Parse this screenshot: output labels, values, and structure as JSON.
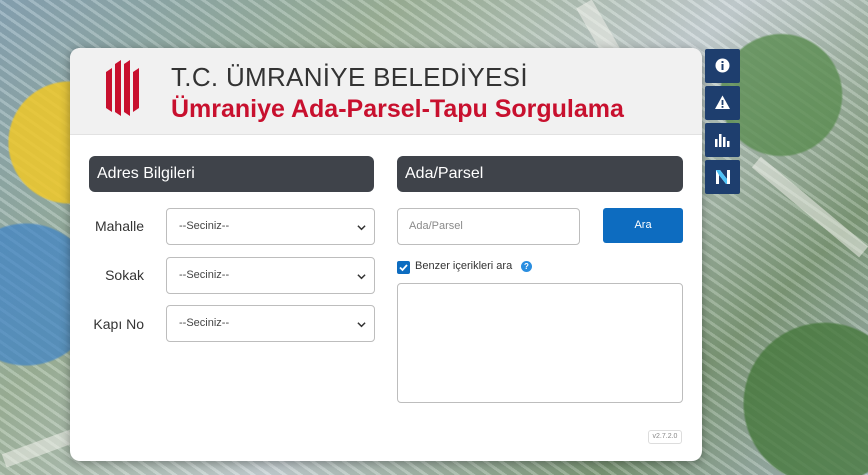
{
  "header": {
    "title": "T.C. ÜMRANİYE BELEDİYESİ",
    "subtitle": "Ümraniye Ada-Parsel-Tapu Sorgulama"
  },
  "address_panel": {
    "title": "Adres Bilgileri",
    "fields": [
      {
        "label": "Mahalle",
        "value": "--Seciniz--"
      },
      {
        "label": "Sokak",
        "value": "--Seciniz--"
      },
      {
        "label": "Kapı No",
        "value": "--Seciniz--"
      }
    ]
  },
  "parcel_panel": {
    "title": "Ada/Parsel",
    "input_placeholder": "Ada/Parsel",
    "search_button": "Ara",
    "similar_checkbox_label": "Benzer içerikleri ara",
    "similar_checked": true,
    "help_glyph": "?"
  },
  "version": "v2.7.2.0",
  "side_toolbar": [
    "info-icon",
    "warning-icon",
    "bar-chart-icon",
    "n-logo-icon"
  ],
  "colors": {
    "brand_red": "#c8102e",
    "panel_header": "#3f434a",
    "accent_blue": "#0d6cc0",
    "toolbar_blue": "#1e3e6e"
  }
}
